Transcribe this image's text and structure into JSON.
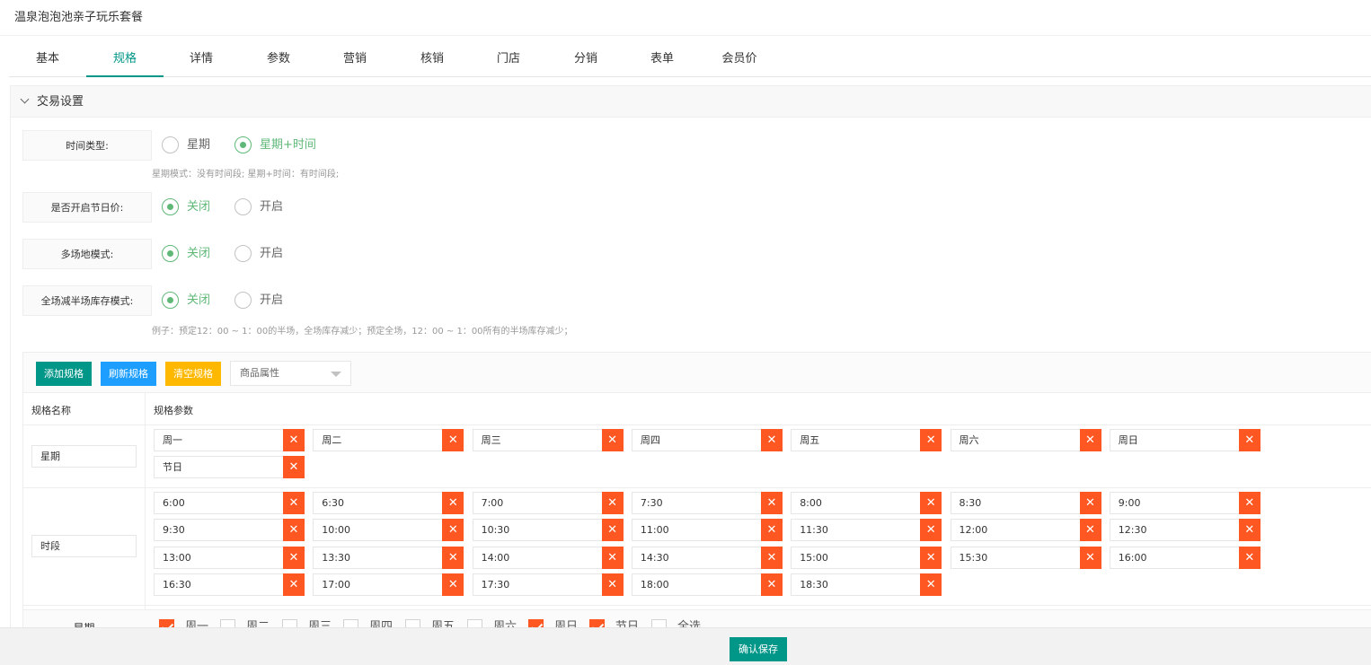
{
  "page_title": "温泉泡泡池亲子玩乐套餐",
  "tabs": [
    {
      "label": "基本",
      "active": false
    },
    {
      "label": "规格",
      "active": true
    },
    {
      "label": "详情",
      "active": false
    },
    {
      "label": "参数",
      "active": false
    },
    {
      "label": "营销",
      "active": false
    },
    {
      "label": "核销",
      "active": false
    },
    {
      "label": "门店",
      "active": false
    },
    {
      "label": "分销",
      "active": false
    },
    {
      "label": "表单",
      "active": false
    },
    {
      "label": "会员价",
      "active": false
    }
  ],
  "section": {
    "title": "交易设置"
  },
  "settings": [
    {
      "label": "时间类型:",
      "options": [
        {
          "label": "星期",
          "checked": false
        },
        {
          "label": "星期+时间",
          "checked": true
        }
      ],
      "hint": "星期模式：没有时间段; 星期+时间：有时间段;"
    },
    {
      "label": "是否开启节日价:",
      "options": [
        {
          "label": "关闭",
          "checked": true
        },
        {
          "label": "开启",
          "checked": false
        }
      ],
      "hint": ""
    },
    {
      "label": "多场地模式:",
      "options": [
        {
          "label": "关闭",
          "checked": true
        },
        {
          "label": "开启",
          "checked": false
        }
      ],
      "hint": ""
    },
    {
      "label": "全场减半场库存模式:",
      "options": [
        {
          "label": "关闭",
          "checked": true
        },
        {
          "label": "开启",
          "checked": false
        }
      ],
      "hint": "例子：预定12：00 ~ 1：00的半场，全场库存减少；预定全场，12：00 ~ 1：00所有的半场库存减少；"
    }
  ],
  "toolbar": {
    "add_label": "添加规格",
    "refresh_label": "刷新规格",
    "clear_label": "清空规格",
    "attr_select": "商品属性"
  },
  "spec_table": {
    "col_name": "规格名称",
    "col_params": "规格参数",
    "rows": [
      {
        "name": "星期",
        "values": [
          "周一",
          "周二",
          "周三",
          "周四",
          "周五",
          "周六",
          "周日",
          "节日"
        ]
      },
      {
        "name": "时段",
        "values": [
          "6:00",
          "6:30",
          "7:00",
          "7:30",
          "8:00",
          "8:30",
          "9:00",
          "9:30",
          "10:00",
          "10:30",
          "11:00",
          "11:30",
          "12:00",
          "12:30",
          "13:00",
          "13:30",
          "14:00",
          "14:30",
          "15:00",
          "15:30",
          "16:00",
          "16:30",
          "17:00",
          "17:30",
          "18:00",
          "18:30"
        ]
      }
    ],
    "remove_glyph": "✕"
  },
  "week_select": {
    "label": "星期",
    "options": [
      {
        "label": "周一",
        "checked": true
      },
      {
        "label": "周二",
        "checked": false
      },
      {
        "label": "周三",
        "checked": false
      },
      {
        "label": "周四",
        "checked": false
      },
      {
        "label": "周五",
        "checked": false
      },
      {
        "label": "周六",
        "checked": false
      },
      {
        "label": "周日",
        "checked": true
      },
      {
        "label": "节日",
        "checked": true
      },
      {
        "label": "全选",
        "checked": false
      }
    ]
  },
  "footer": {
    "save_label": "确认保存"
  },
  "colors": {
    "primary": "#009688",
    "accent_radio": "#5fb878",
    "danger": "#ff5722",
    "blue": "#1e9fff",
    "yellow": "#ffb800"
  }
}
